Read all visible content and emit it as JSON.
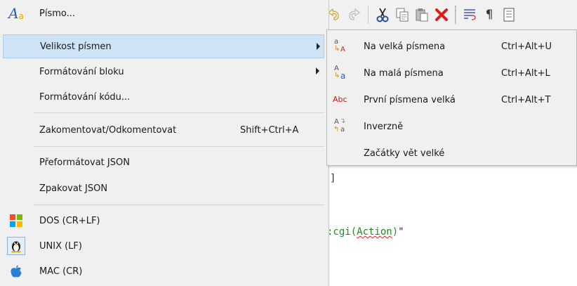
{
  "menu": {
    "items": [
      {
        "label": "Písmo...",
        "icon": "font-icon"
      },
      {
        "label": "Velikost písmen",
        "submenu": true
      },
      {
        "label": "Formátování bloku",
        "submenu": true
      },
      {
        "label": "Formátování kódu..."
      },
      {
        "label": "Zakomentovat/Odkomentovat",
        "shortcut": "Shift+Ctrl+A"
      },
      {
        "label": "Přeformátovat JSON"
      },
      {
        "label": "Zpakovat JSON"
      },
      {
        "label": "DOS  (CR+LF)",
        "icon": "windows-icon"
      },
      {
        "label": "UNIX  (LF)",
        "icon": "linux-icon"
      },
      {
        "label": "MAC  (CR)",
        "icon": "apple-icon"
      }
    ]
  },
  "submenu": {
    "items": [
      {
        "label": "Na velká písmena",
        "shortcut": "Ctrl+Alt+U",
        "icon": "uppercase-icon"
      },
      {
        "label": "Na malá písmena",
        "shortcut": "Ctrl+Alt+L",
        "icon": "lowercase-icon"
      },
      {
        "label": "První písmena velká",
        "shortcut": "Ctrl+Alt+T",
        "icon": "capitalize-icon"
      },
      {
        "label": "Inverzně",
        "icon": "invert-case-icon"
      },
      {
        "label": "Začátky vět velké"
      }
    ]
  },
  "icon_glyphs": {
    "font_big": "A",
    "font_small": "a",
    "uppercase_small": "a",
    "uppercase_big": "A",
    "lowercase_big": "A",
    "lowercase_small": "a",
    "capitalize": "Abc",
    "invert_big": "A",
    "invert_small": "a"
  },
  "editor": {
    "bracket": "]",
    "code_prefix": ":cgi(",
    "code_word": "Action",
    "code_suffix": ")",
    "code_quote": "\""
  },
  "colors": {
    "highlight": "#cfe3f7",
    "delete_red": "#e01b1b",
    "code_green": "#1f8a1f"
  }
}
